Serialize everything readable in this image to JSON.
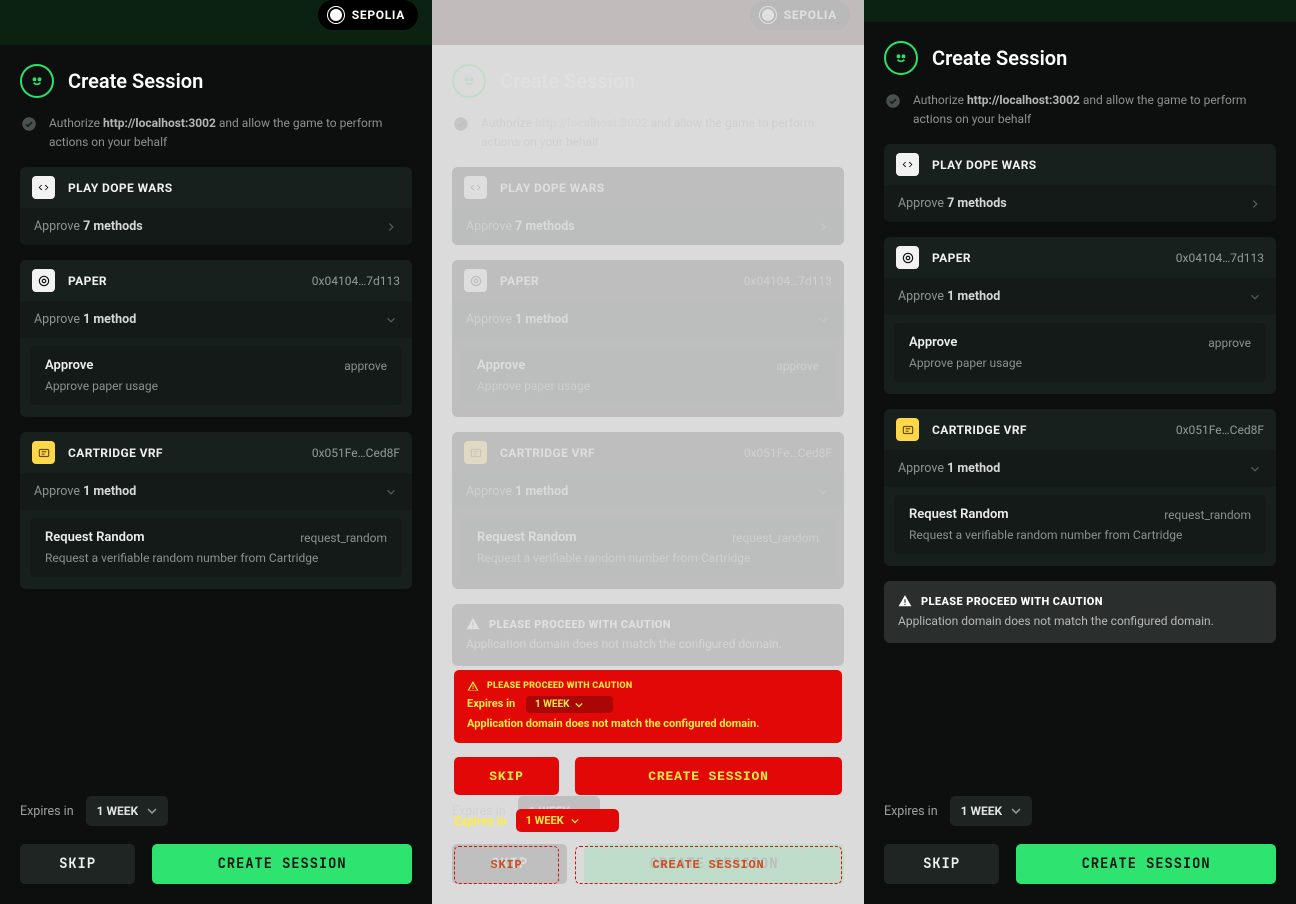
{
  "pages": {
    "left": {
      "heroStyle": "green",
      "hasWarning": false
    },
    "middle": {
      "heroStyle": "red",
      "hasWarning": true
    },
    "right": {
      "heroStyle": "green",
      "hasWarning": true
    }
  },
  "network": {
    "label": "SEPOLIA"
  },
  "title": "Create Session",
  "authorize": {
    "prefix": "Authorize ",
    "url": "http://localhost:3002",
    "suffix": " and allow the game to perform actions on your behalf"
  },
  "sections": [
    {
      "id": "dope-wars",
      "icon": "code-icon",
      "title": "PLAY DOPE WARS",
      "address": "",
      "summary_prefix": "Approve ",
      "summary_bold": "7 methods",
      "expanded": false
    },
    {
      "id": "paper",
      "icon": "target-icon",
      "title": "PAPER",
      "address": "0x04104…7d113",
      "summary_prefix": "Approve ",
      "summary_bold": "1 method",
      "expanded": true,
      "method": {
        "name": "Approve",
        "selector": "approve",
        "desc": "Approve paper usage"
      }
    },
    {
      "id": "cartridge-vrf",
      "icon": "vrf-icon",
      "title": "CARTRIDGE VRF",
      "iconClass": "yellow",
      "address": "0x051Fe…Ced8F",
      "summary_prefix": "Approve ",
      "summary_bold": "1 method",
      "expanded": true,
      "method": {
        "name": "Request Random",
        "selector": "request_random",
        "desc": "Request a verifiable random number from Cartridge"
      }
    }
  ],
  "warning": {
    "title": "PLEASE PROCEED WITH CAUTION",
    "message": "Application domain does not match the configured domain."
  },
  "expiry": {
    "label": "Expires in",
    "value": "1 WEEK"
  },
  "buttons": {
    "skip": "SKIP",
    "create": "CREATE SESSION"
  },
  "glitch": {
    "warn_title": "PLEASE PROCEED WITH CAUTION",
    "warn_msg": "Application domain does not match the configured domain.",
    "expires_label": "Expires in",
    "expires_value": "1 WEEK",
    "skip": "SKIP",
    "create": "CREATE SESSION"
  }
}
